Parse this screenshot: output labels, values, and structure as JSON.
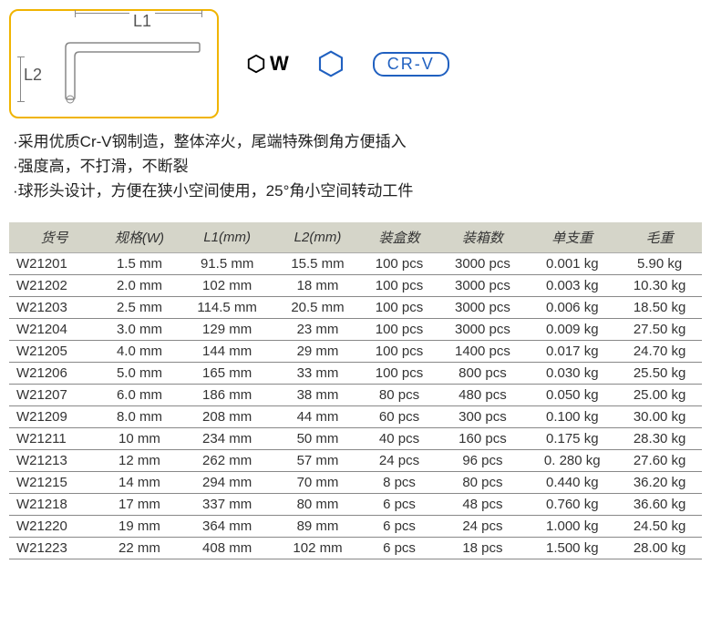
{
  "diagram": {
    "l1_label": "L1",
    "l2_label": "L2",
    "w_label": "W",
    "crv_label": "CR-V"
  },
  "description": [
    "·采用优质Cr-V钢制造，整体淬火，尾端特殊倒角方便插入",
    "·强度高，不打滑，不断裂",
    "·球形头设计，方便在狭小空间使用，25°角小空间转动工件"
  ],
  "table": {
    "headers": [
      "货号",
      "规格(W)",
      "L1(mm)",
      "L2(mm)",
      "装盒数",
      "装箱数",
      "单支重",
      "毛重"
    ],
    "rows": [
      [
        "W21201",
        "1.5 mm",
        "91.5 mm",
        "15.5 mm",
        "100  pcs",
        "3000 pcs",
        "0.001 kg",
        "5.90 kg"
      ],
      [
        "W21202",
        "2.0 mm",
        "102 mm",
        "18 mm",
        "100  pcs",
        "3000 pcs",
        "0.003 kg",
        "10.30 kg"
      ],
      [
        "W21203",
        "2.5 mm",
        "114.5 mm",
        "20.5 mm",
        "100  pcs",
        "3000 pcs",
        "0.006 kg",
        "18.50 kg"
      ],
      [
        "W21204",
        "3.0 mm",
        "129 mm",
        "23 mm",
        "100  pcs",
        "3000 pcs",
        "0.009 kg",
        "27.50 kg"
      ],
      [
        "W21205",
        "4.0 mm",
        "144 mm",
        "29 mm",
        "100  pcs",
        "1400 pcs",
        "0.017 kg",
        "24.70 kg"
      ],
      [
        "W21206",
        "5.0 mm",
        "165 mm",
        "33 mm",
        "100  pcs",
        "800 pcs",
        "0.030 kg",
        "25.50 kg"
      ],
      [
        "W21207",
        "6.0 mm",
        "186 mm",
        "38 mm",
        "80  pcs",
        "480 pcs",
        "0.050 kg",
        "25.00 kg"
      ],
      [
        "W21209",
        "8.0 mm",
        "208 mm",
        "44 mm",
        "60  pcs",
        "300 pcs",
        "0.100 kg",
        "30.00 kg"
      ],
      [
        "W21211",
        "10 mm",
        "234 mm",
        "50 mm",
        "40  pcs",
        "160 pcs",
        "0.175 kg",
        "28.30 kg"
      ],
      [
        "W21213",
        "12 mm",
        "262 mm",
        "57 mm",
        "24  pcs",
        "96 pcs",
        "0. 280 kg",
        "27.60 kg"
      ],
      [
        "W21215",
        "14 mm",
        "294 mm",
        "70 mm",
        "8  pcs",
        "80 pcs",
        "0.440 kg",
        "36.20 kg"
      ],
      [
        "W21218",
        "17 mm",
        "337 mm",
        "80 mm",
        "6  pcs",
        "48 pcs",
        "0.760 kg",
        "36.60 kg"
      ],
      [
        "W21220",
        "19 mm",
        "364 mm",
        "89 mm",
        "6  pcs",
        "24 pcs",
        "1.000 kg",
        "24.50 kg"
      ],
      [
        "W21223",
        "22 mm",
        "408 mm",
        "102 mm",
        "6  pcs",
        "18 pcs",
        "1.500 kg",
        "28.00 kg"
      ]
    ]
  }
}
